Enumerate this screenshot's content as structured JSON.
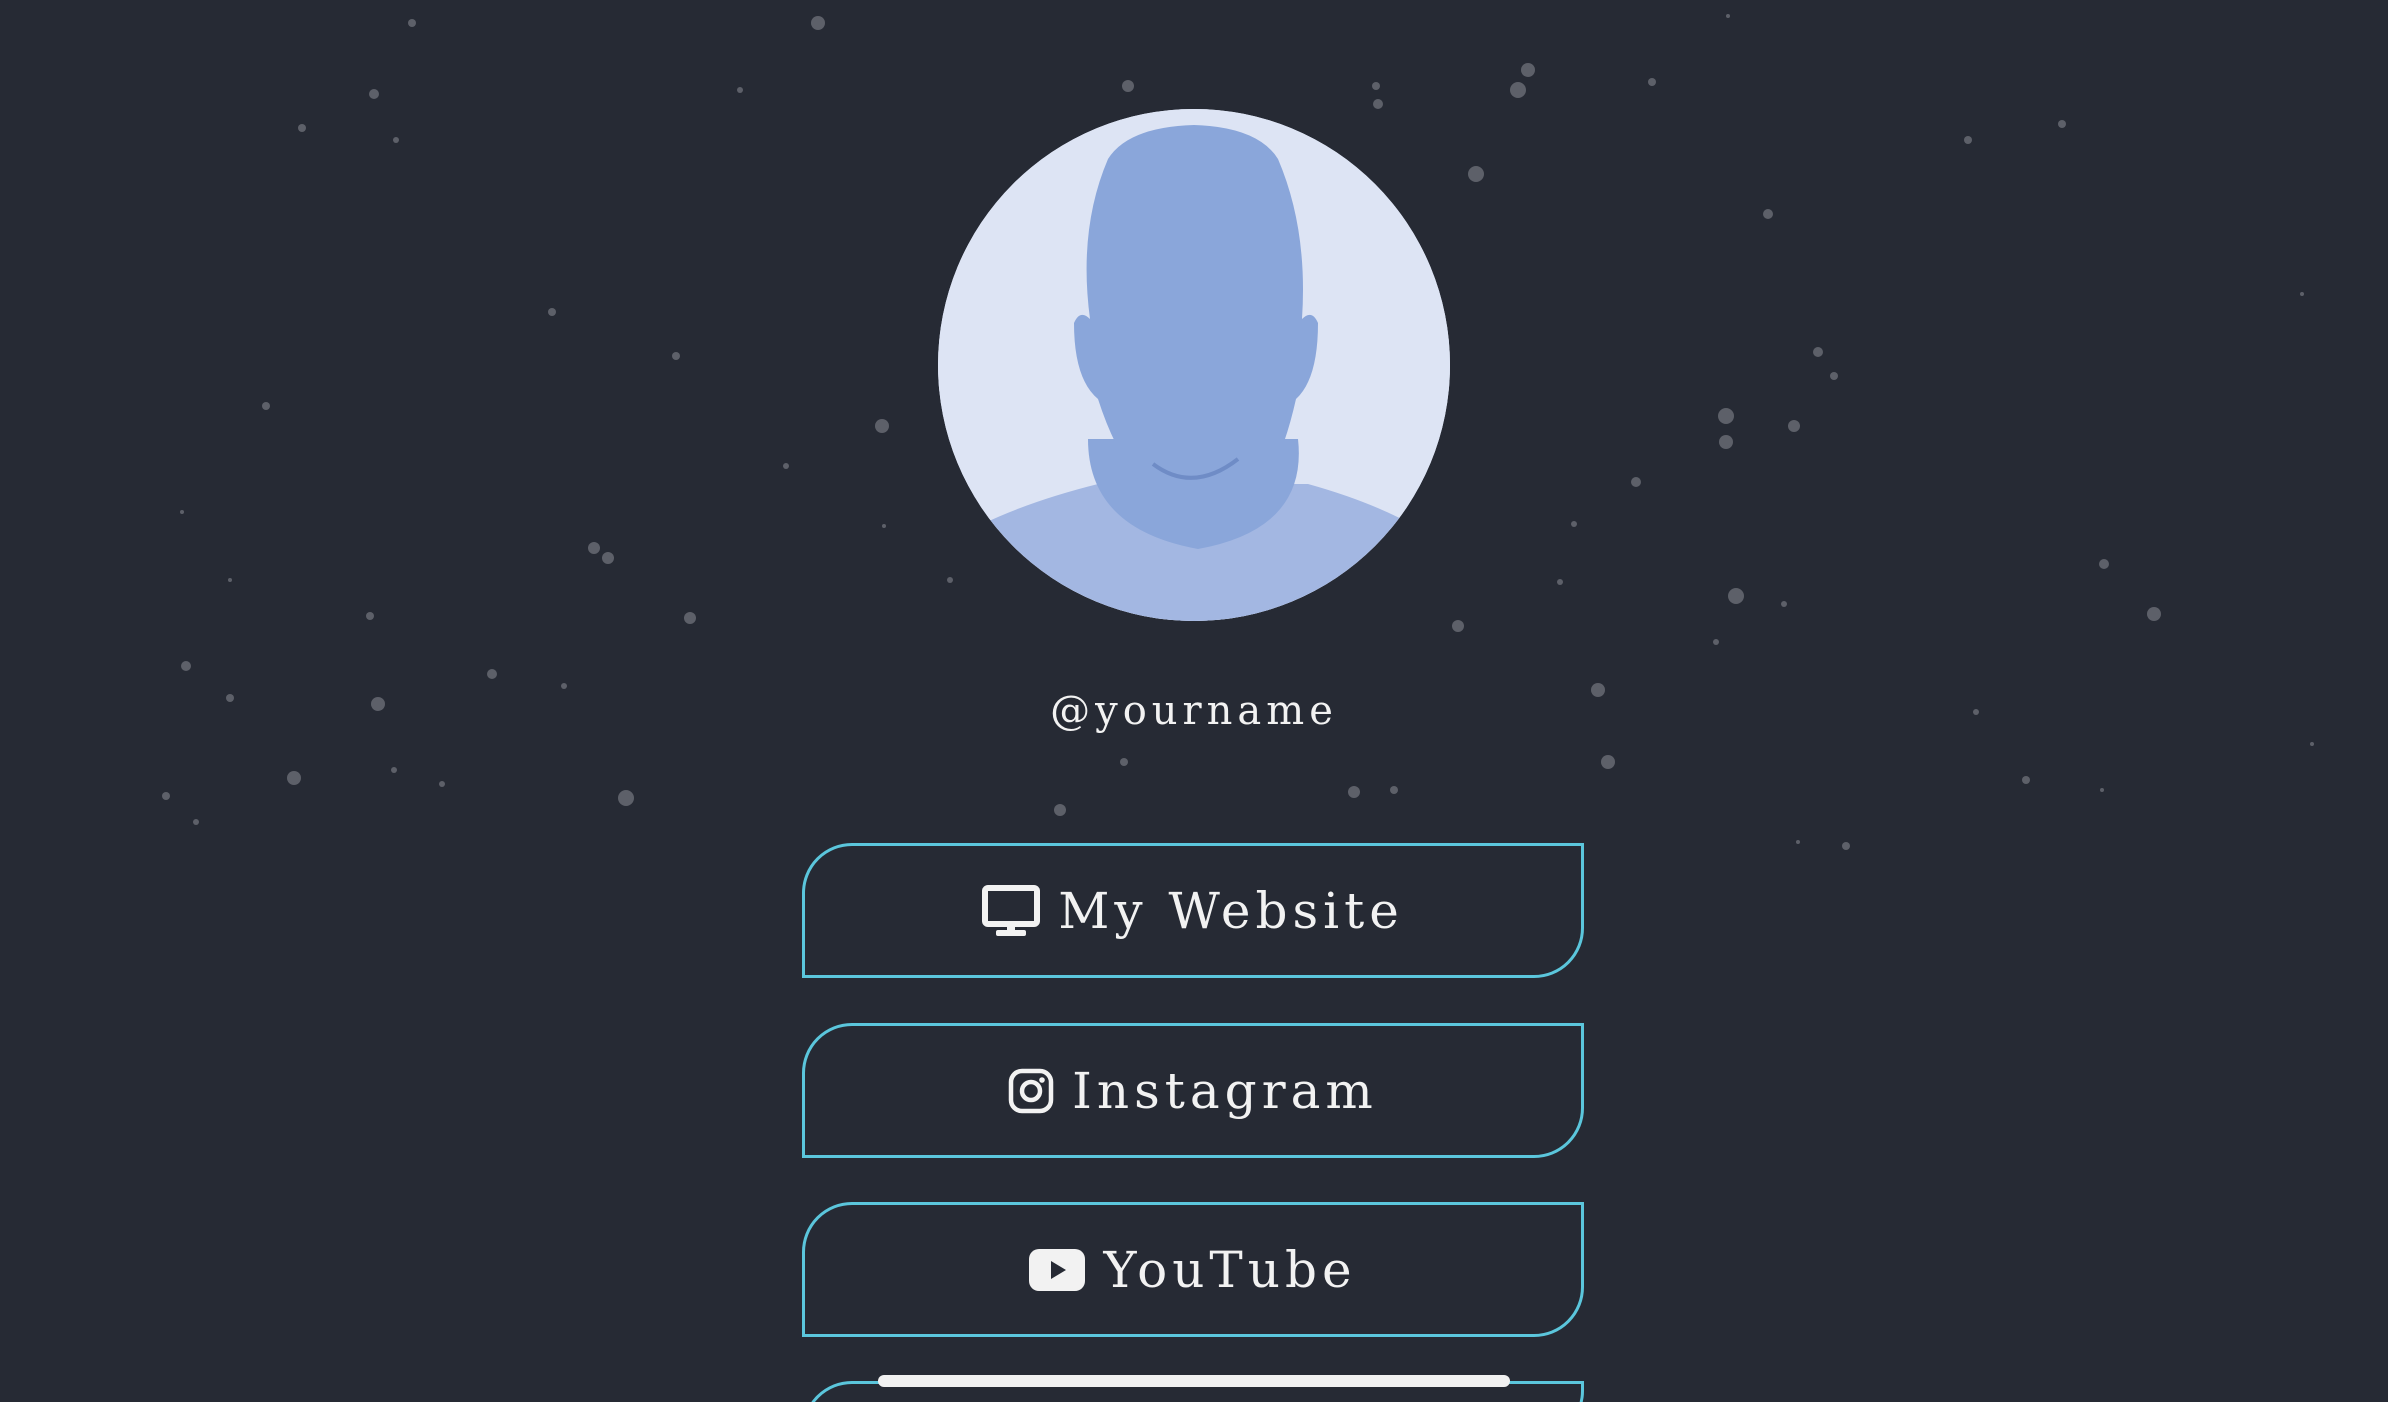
{
  "profile": {
    "username": "@yourname",
    "avatar_icon": "default-user-silhouette"
  },
  "links": [
    {
      "label": "My Website",
      "icon": "monitor-icon"
    },
    {
      "label": "Instagram",
      "icon": "instagram-icon"
    },
    {
      "label": "YouTube",
      "icon": "youtube-icon"
    }
  ],
  "colors": {
    "background": "#262a34",
    "button_border": "#5bc6dc",
    "text": "#f2f2f2",
    "avatar_background": "#dde4f4",
    "avatar_silhouette": "#8aa6da",
    "star": "#5d6069"
  }
}
